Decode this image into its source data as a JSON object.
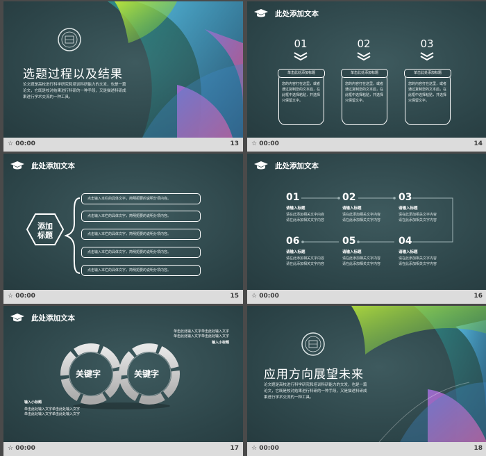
{
  "slides": {
    "s13": {
      "title": "选题过程以及结果",
      "para": "论文题是高校进行科学研究和培训科研能力的文发，也是一篇论文，它既是校对结果进行科研的一种手段，又是描述科研成果进行学术交流的一种工具。",
      "time": "00:00",
      "number": "13"
    },
    "s14": {
      "heading": "此处添加文本",
      "steps": [
        {
          "num": "01",
          "title": "单击此处添加标题",
          "body": "您的内容打在这里，或者通过复制您的文本后，在此框中选择粘贴，并选择只保留文字。"
        },
        {
          "num": "02",
          "title": "单击此处添加标题",
          "body": "您的内容打在这里，或者通过复制您的文本后，在此框中选择粘贴，并选择只保留文字。"
        },
        {
          "num": "03",
          "title": "单击此处添加标题",
          "body": "您的内容打在这里，或者通过复制您的文本后，在此框中选择粘贴，并选择只保留文字。"
        }
      ],
      "time": "00:00",
      "number": "14"
    },
    "s15": {
      "heading": "此处添加文本",
      "center_line1": "添加",
      "center_line2": "标题",
      "items": [
        "点击输入本栏的具体文字，简明扼要的说明分项内容。",
        "点击输入本栏的具体文字，简明扼要的说明分项内容。",
        "点击输入本栏的具体文字，简明扼要的说明分项内容。",
        "点击输入本栏的具体文字，简明扼要的说明分项内容。",
        "点击输入本栏的具体文字，简明扼要的说明分项内容。"
      ],
      "time": "00:00",
      "number": "15"
    },
    "s16": {
      "heading": "此处添加文本",
      "points": [
        {
          "num": "01",
          "title": "请输入标题",
          "desc": "请在此添加相关文字内容请在此添加相关文字内容"
        },
        {
          "num": "02",
          "title": "请输入标题",
          "desc": "请在此添加相关文字内容请在此添加相关文字内容"
        },
        {
          "num": "03",
          "title": "请输入标题",
          "desc": "请在此添加相关文字内容请在此添加相关文字内容"
        },
        {
          "num": "04",
          "title": "请输入标题",
          "desc": "请在此添加相关文字内容请在此添加相关文字内容"
        },
        {
          "num": "05",
          "title": "请输入标题",
          "desc": "请在此添加相关文字内容请在此添加相关文字内容"
        },
        {
          "num": "06",
          "title": "请输入标题",
          "desc": "请在此添加相关文字内容请在此添加相关文字内容"
        }
      ],
      "time": "00:00",
      "number": "16"
    },
    "s17": {
      "heading": "此处添加文本",
      "keyword_left": "关键字",
      "keyword_right": "关键字",
      "note_right_line1": "单击此处输入文字单击此处输入文字",
      "note_right_line2": "单击此处输入文字单击此处输入文字",
      "note_right_title": "输入小标题",
      "note_left_title": "输入小标题",
      "note_left_line1": "单击此处输入文字单击此处输入文字",
      "note_left_line2": "单击此处输入文字单击此处输入文字",
      "time": "00:00",
      "number": "17"
    },
    "s18": {
      "title": "应用方向展望未来",
      "para": "论文题是高校进行科学研究和培训科研能力的文发，也是一篇论文，它既是校对结果进行科研的一种手段，又是描述科研成果进行学术交流的一种工具。",
      "time": "00:00",
      "number": "18"
    }
  },
  "icons": {
    "graduation": "graduation-cap-icon",
    "clock": "clock-icon"
  },
  "colors": {
    "bg": "#2c4448",
    "bar": "#dcdcdc",
    "accent_green": "#9fd33a",
    "accent_blue": "#3aa8e0",
    "accent_pink": "#e0508f"
  }
}
